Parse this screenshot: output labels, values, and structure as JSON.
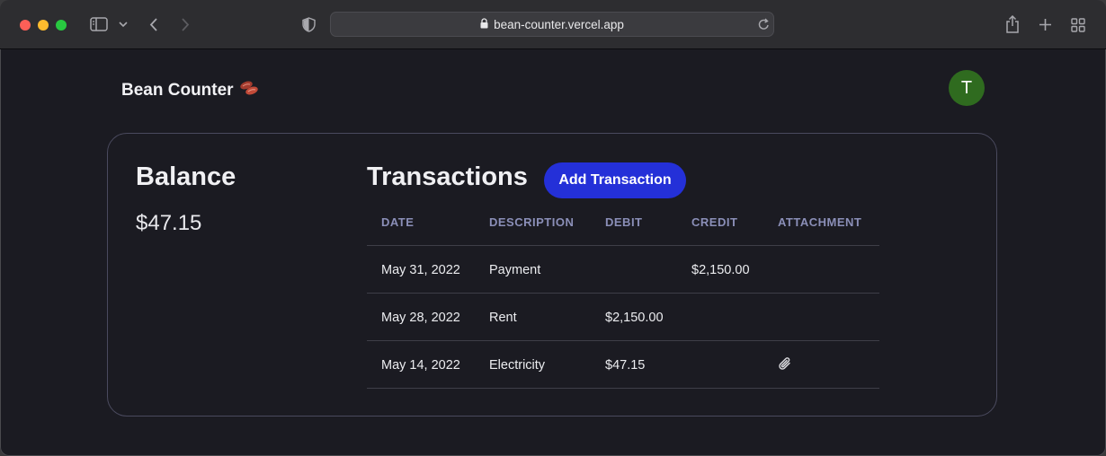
{
  "browser": {
    "url": "bean-counter.vercel.app"
  },
  "app": {
    "brand": "Bean Counter",
    "brand_emoji": "🫘",
    "avatar_initial": "T"
  },
  "balance": {
    "title": "Balance",
    "amount": "$47.15"
  },
  "transactions": {
    "title": "Transactions",
    "add_button": "Add Transaction",
    "columns": [
      "DATE",
      "DESCRIPTION",
      "DEBIT",
      "CREDIT",
      "ATTACHMENT"
    ],
    "rows": [
      {
        "date": "May 31, 2022",
        "description": "Payment",
        "debit": "",
        "credit": "$2,150.00",
        "attachment": ""
      },
      {
        "date": "May 28, 2022",
        "description": "Rent",
        "debit": "$2,150.00",
        "credit": "",
        "attachment": ""
      },
      {
        "date": "May 14, 2022",
        "description": "Electricity",
        "debit": "$47.15",
        "credit": "",
        "attachment": "paperclip-icon"
      }
    ]
  },
  "colors": {
    "page_bg": "#1b1b22",
    "accent": "#2430d8",
    "avatar": "#2f6b1f",
    "header_text": "#8b8fb8"
  }
}
